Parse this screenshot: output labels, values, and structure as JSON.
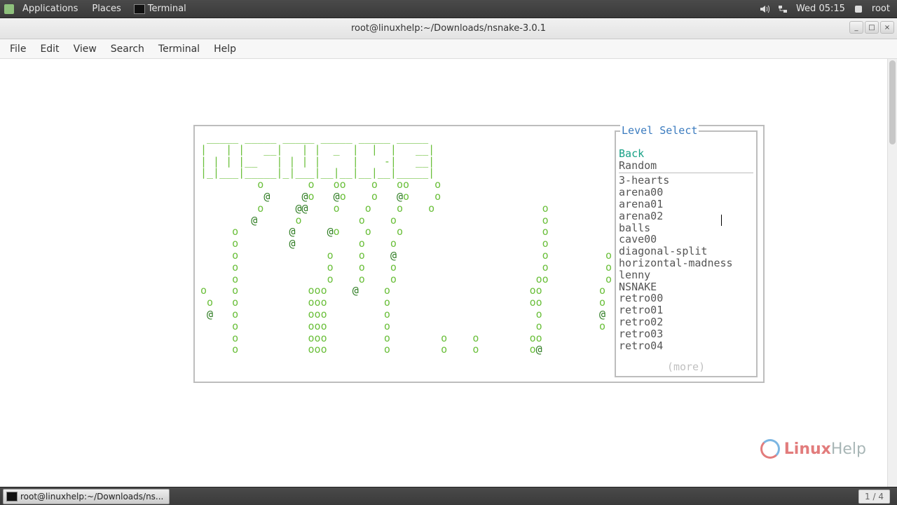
{
  "top_panel": {
    "apps": "Applications",
    "places": "Places",
    "terminal": "Terminal",
    "clock": "Wed 05:15",
    "user": "root"
  },
  "window": {
    "title": "root@linuxhelp:~/Downloads/nsnake-3.0.1",
    "menu": [
      "File",
      "Edit",
      "View",
      "Search",
      "Terminal",
      "Help"
    ]
  },
  "ascii_logo": " _____ _____ _____ _____ _____ _____\n|   | |   __|   | |  _  |  |  |   __|\n| | | |__   | | | |     |    -|   __|\n|_|___|_____|_|___|__|__|__|__|_____|",
  "ascii_field_lines": [
    "         o       o   oo    o   oo    o",
    "          @     @o   @o    o   @o    o",
    "         o     @@    o    o    o    o                 o",
    "        @      o         o    o                       o",
    "     o        @     @o    o    o                      o",
    "     o        @          o    o                       o",
    "     o              o    o    @                       o         o",
    "     o              o    o    o                       o         o",
    "     o              o    o    o                      oo         o",
    "o    o           ooo    @    o                      oo         o",
    " o   o           ooo         o                      oo         o",
    " @   o           ooo         o                       o         @",
    "     o           ooo         o                       o         o",
    "     o           ooo         o        o    o        oo",
    "     o           ooo         o        o    o        o@"
  ],
  "level_select": {
    "title": "Level Select",
    "back": "Back",
    "random": "Random",
    "levels": [
      "3-hearts",
      "arena00",
      "arena01",
      "arena02",
      "balls",
      "cave00",
      "diagonal-split",
      "horizontal-madness",
      "lenny",
      "NSNAKE",
      "retro00",
      "retro01",
      "retro02",
      "retro03",
      "retro04"
    ],
    "more": "(more)"
  },
  "taskbar": {
    "task": "root@linuxhelp:~/Downloads/ns...",
    "pager": "1 / 4"
  },
  "watermark": {
    "brand_accent": "Linux",
    "brand_rest": "Help"
  }
}
